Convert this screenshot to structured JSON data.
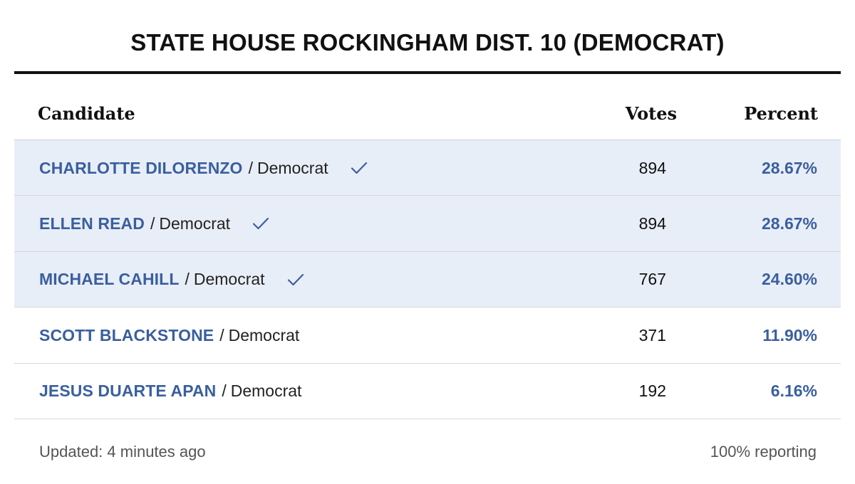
{
  "title": "STATE HOUSE ROCKINGHAM DIST. 10 (DEMOCRAT)",
  "columns": {
    "candidate": "Candidate",
    "votes": "Votes",
    "percent": "Percent"
  },
  "separator": "/",
  "rows": [
    {
      "name": "CHARLOTTE DILORENZO",
      "party": "Democrat",
      "winner": true,
      "votes": "894",
      "percent": "28.67%"
    },
    {
      "name": "ELLEN READ",
      "party": "Democrat",
      "winner": true,
      "votes": "894",
      "percent": "28.67%"
    },
    {
      "name": "MICHAEL CAHILL",
      "party": "Democrat",
      "winner": true,
      "votes": "767",
      "percent": "24.60%"
    },
    {
      "name": "SCOTT BLACKSTONE",
      "party": "Democrat",
      "winner": false,
      "votes": "371",
      "percent": "11.90%"
    },
    {
      "name": "JESUS DUARTE APAN",
      "party": "Democrat",
      "winner": false,
      "votes": "192",
      "percent": "6.16%"
    }
  ],
  "footer": {
    "updated": "Updated: 4 minutes ago",
    "reporting": "100% reporting"
  },
  "colors": {
    "accent": "#3a5f9f",
    "winner_row_bg": "#e8eef7",
    "text": "#111111",
    "muted": "#555555"
  },
  "icons": {
    "winner": "check-icon"
  }
}
